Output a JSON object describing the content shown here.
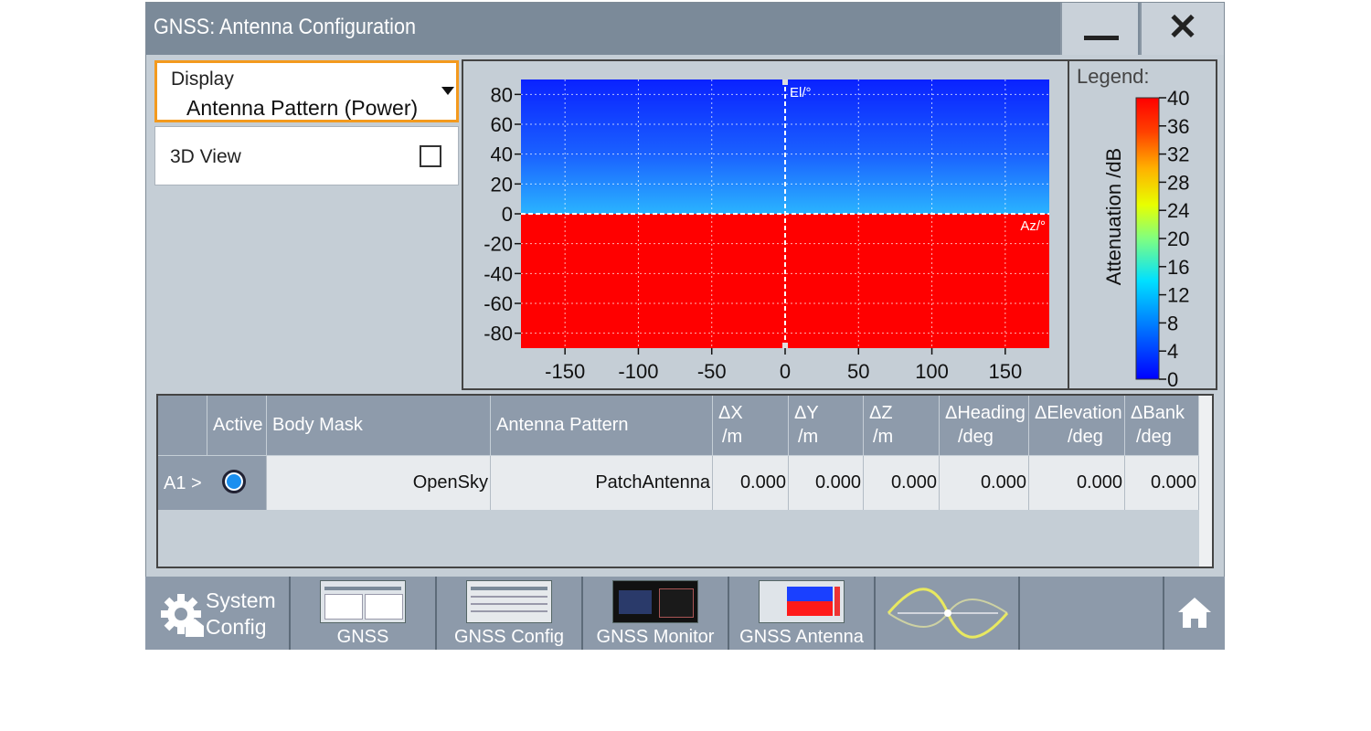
{
  "window": {
    "title": "GNSS: Antenna Configuration"
  },
  "controls": {
    "display_label": "Display",
    "display_value": "Antenna Pattern (Power)",
    "view3d_label": "3D View",
    "view3d_checked": false
  },
  "legend": {
    "title": "Legend:"
  },
  "chart_data": [
    {
      "type": "heatmap",
      "title": "",
      "xlabel": "Az/°",
      "ylabel": "El/°",
      "xlim": [
        -180,
        180
      ],
      "ylim": [
        -90,
        90
      ],
      "xticks": [
        -150,
        -100,
        -50,
        0,
        50,
        100,
        150
      ],
      "yticks": [
        80,
        60,
        40,
        20,
        0,
        -20,
        -40,
        -60,
        -80
      ],
      "grid": true,
      "regions": [
        {
          "elevation_range": [
            0,
            90
          ],
          "attenuation_dB": [
            0,
            12
          ],
          "description_color": "blue gradient"
        },
        {
          "elevation_range": [
            -90,
            0
          ],
          "attenuation_dB": 40,
          "description_color": "#ff0000"
        }
      ],
      "colorbar": {
        "label": "Attenuation /dB",
        "range": [
          0,
          40
        ],
        "ticks": [
          40,
          36,
          32,
          28,
          24,
          20,
          16,
          12,
          8,
          4,
          0
        ]
      }
    }
  ],
  "table": {
    "headers": [
      {
        "id": "active",
        "line1": "Active",
        "line2": ""
      },
      {
        "id": "body_mask",
        "line1": "Body Mask",
        "line2": ""
      },
      {
        "id": "antenna_pattern",
        "line1": "Antenna Pattern",
        "line2": ""
      },
      {
        "id": "dx",
        "line1": "ΔX",
        "line2": "/m"
      },
      {
        "id": "dy",
        "line1": "ΔY",
        "line2": "/m"
      },
      {
        "id": "dz",
        "line1": "ΔZ",
        "line2": "/m"
      },
      {
        "id": "dheading",
        "line1": "ΔHeading",
        "line2": "/deg"
      },
      {
        "id": "delevation",
        "line1": "ΔElevation",
        "line2": "/deg"
      },
      {
        "id": "dbank",
        "line1": "ΔBank",
        "line2": "/deg"
      }
    ],
    "rows": [
      {
        "row_label": "A1 >",
        "active": true,
        "body_mask": "OpenSky",
        "antenna_pattern": "PatchAntenna",
        "dx": "0.000",
        "dy": "0.000",
        "dz": "0.000",
        "dheading": "0.000",
        "delevation": "0.000",
        "dbank": "0.000"
      }
    ]
  },
  "taskbar": {
    "system_config": [
      "System",
      "Config"
    ],
    "items": [
      "GNSS",
      "GNSS Config",
      "GNSS Monitor",
      "GNSS Antenna"
    ]
  },
  "colors": {
    "accent": "#f39a1e",
    "titlebar": "#7b8a99",
    "header": "#8e9bab",
    "radio": "#1a8ff0"
  }
}
